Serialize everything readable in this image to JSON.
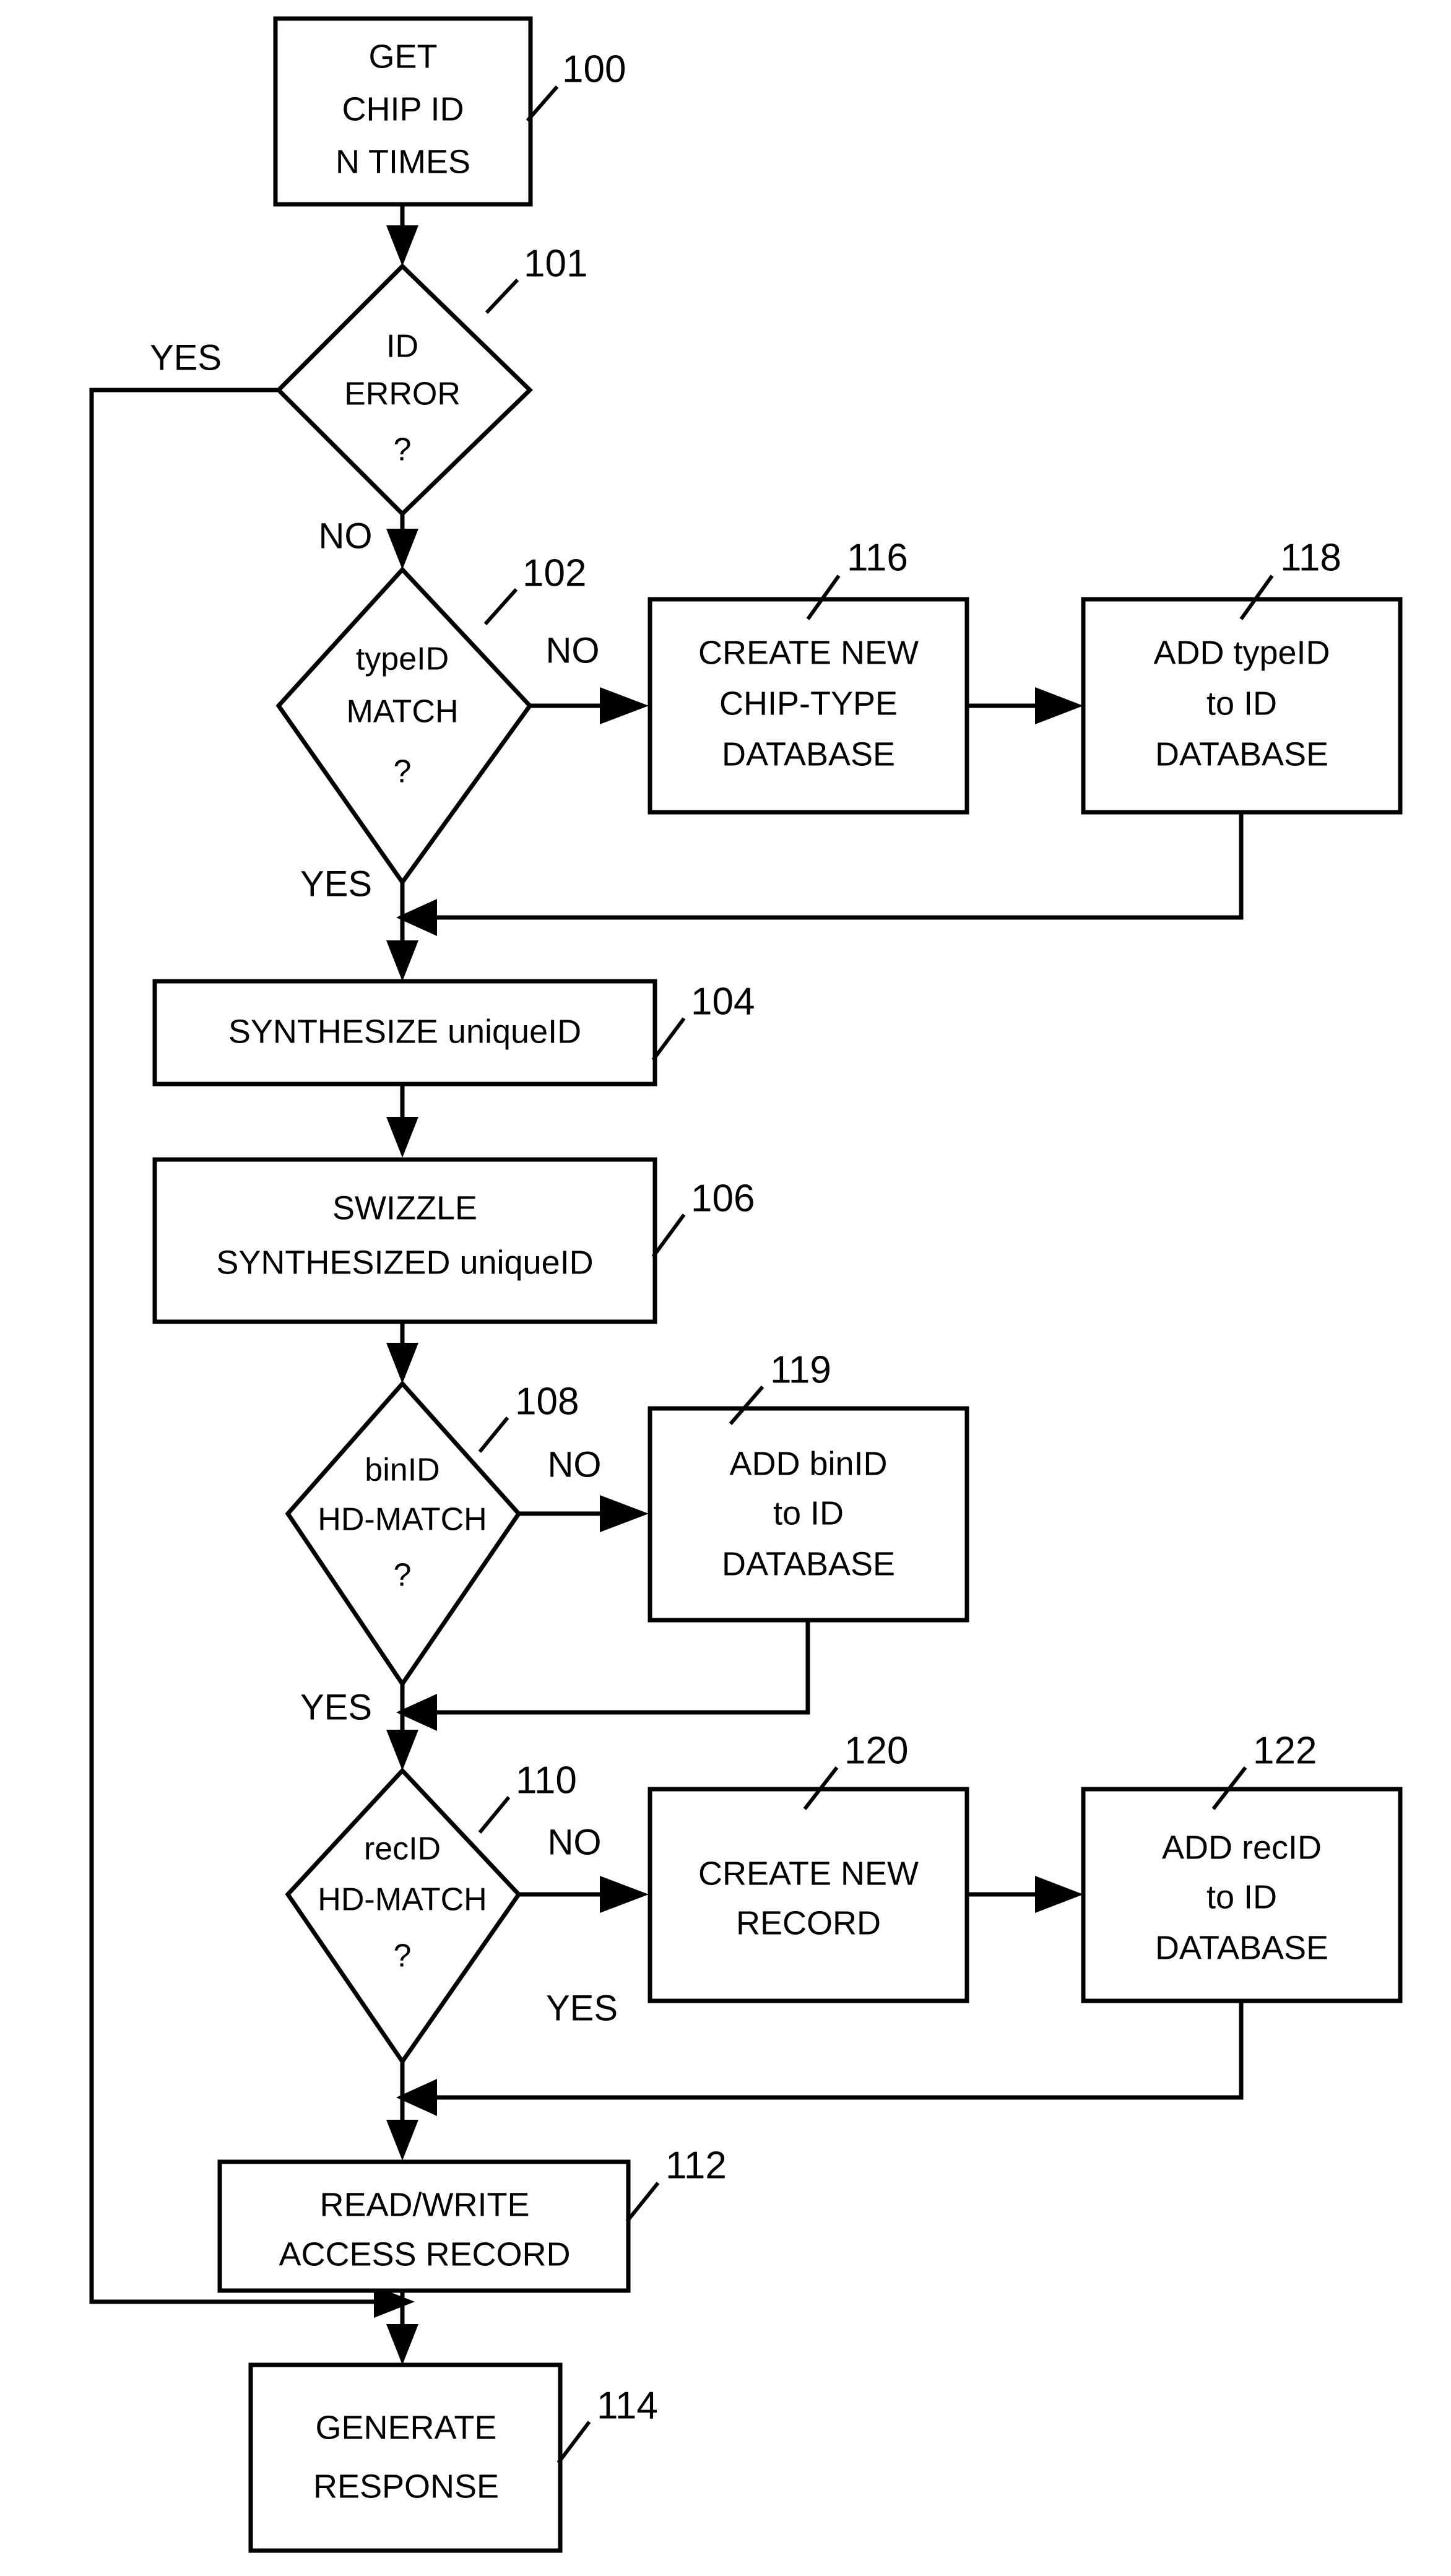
{
  "figure": {
    "type": "flowchart",
    "title": "",
    "line_color": "#000000",
    "fill_color": "#ffffff",
    "background": "#ffffff"
  },
  "nodes": {
    "n100": {
      "ref": "100",
      "shape": "process",
      "lines": [
        "GET",
        "CHIP ID",
        "N TIMES"
      ]
    },
    "n101": {
      "ref": "101",
      "shape": "decision",
      "lines": [
        "ID",
        "ERROR",
        "?"
      ]
    },
    "n102": {
      "ref": "102",
      "shape": "decision",
      "lines": [
        "typeID",
        "MATCH",
        "?"
      ]
    },
    "n116": {
      "ref": "116",
      "shape": "process",
      "lines": [
        "CREATE NEW",
        "CHIP-TYPE",
        "DATABASE"
      ]
    },
    "n118": {
      "ref": "118",
      "shape": "process",
      "lines": [
        "ADD typeID",
        "to ID",
        "DATABASE"
      ]
    },
    "n104": {
      "ref": "104",
      "shape": "process",
      "lines": [
        "SYNTHESIZE uniqueID"
      ]
    },
    "n106": {
      "ref": "106",
      "shape": "process",
      "lines": [
        "SWIZZLE",
        "SYNTHESIZED uniqueID"
      ]
    },
    "n108": {
      "ref": "108",
      "shape": "decision",
      "lines": [
        "binID",
        "HD-MATCH",
        "?"
      ]
    },
    "n119": {
      "ref": "119",
      "shape": "process",
      "lines": [
        "ADD binID",
        "to ID",
        "DATABASE"
      ]
    },
    "n110": {
      "ref": "110",
      "shape": "decision",
      "lines": [
        "recID",
        "HD-MATCH",
        "?"
      ]
    },
    "n120": {
      "ref": "120",
      "shape": "process",
      "lines": [
        "CREATE NEW",
        "RECORD"
      ]
    },
    "n122": {
      "ref": "122",
      "shape": "process",
      "lines": [
        "ADD recID",
        "to ID",
        "DATABASE"
      ]
    },
    "n112": {
      "ref": "112",
      "shape": "process",
      "lines": [
        "READ/WRITE",
        "ACCESS  RECORD"
      ]
    },
    "n114": {
      "ref": "114",
      "shape": "process",
      "lines": [
        "GENERATE",
        "RESPONSE"
      ]
    }
  },
  "edge_labels": {
    "e101_yes": "YES",
    "e101_no": "NO",
    "e102_no": "NO",
    "e102_yes": "YES",
    "e108_no": "NO",
    "e108_yes": "YES",
    "e110_no": "NO",
    "e110_yes": "YES"
  }
}
